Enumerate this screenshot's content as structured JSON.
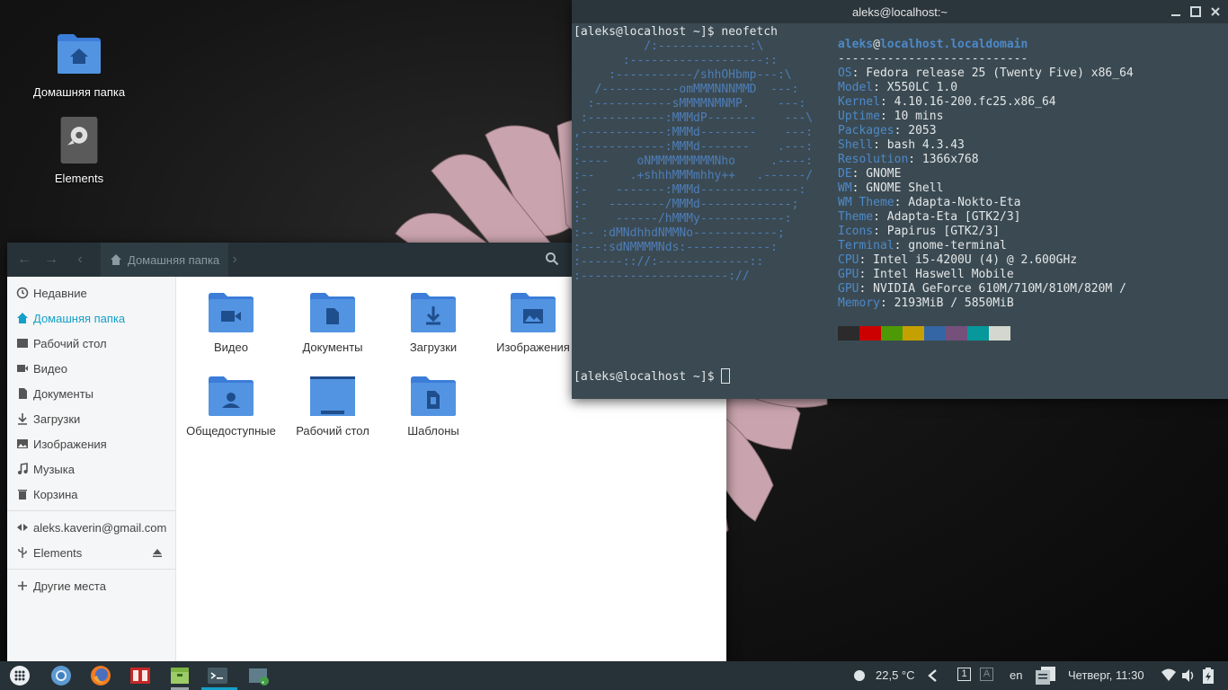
{
  "desktop": {
    "icons": [
      {
        "label": "Домашняя папка"
      },
      {
        "label": "Elements"
      }
    ]
  },
  "file_manager": {
    "breadcrumb": "Домашняя папка",
    "sidebar": [
      {
        "label": "Недавние"
      },
      {
        "label": "Домашняя папка"
      },
      {
        "label": "Рабочий стол"
      },
      {
        "label": "Видео"
      },
      {
        "label": "Документы"
      },
      {
        "label": "Загрузки"
      },
      {
        "label": "Изображения"
      },
      {
        "label": "Музыка"
      },
      {
        "label": "Корзина"
      },
      {
        "label": "aleks.kaverin@gmail.com"
      },
      {
        "label": "Elements"
      },
      {
        "label": "Другие места"
      }
    ],
    "folders": [
      {
        "label": "Видео"
      },
      {
        "label": "Документы"
      },
      {
        "label": "Загрузки"
      },
      {
        "label": "Изображения"
      },
      {
        "label": "Общедоступные"
      },
      {
        "label": "Рабочий стол"
      },
      {
        "label": "Шаблоны"
      }
    ]
  },
  "terminal": {
    "title": "aleks@localhost:~",
    "prompt": "[aleks@localhost ~]$ ",
    "command": "neofetch",
    "user": "aleks",
    "at": "@",
    "host": "localhost.localdomain",
    "separator": "---------------------------",
    "info": [
      {
        "key": "OS",
        "value": "Fedora release 25 (Twenty Five) x86_64"
      },
      {
        "key": "Model",
        "value": "X550LC 1.0"
      },
      {
        "key": "Kernel",
        "value": "4.10.16-200.fc25.x86_64"
      },
      {
        "key": "Uptime",
        "value": "10 mins"
      },
      {
        "key": "Packages",
        "value": "2053"
      },
      {
        "key": "Shell",
        "value": "bash 4.3.43"
      },
      {
        "key": "Resolution",
        "value": "1366x768"
      },
      {
        "key": "DE",
        "value": "GNOME"
      },
      {
        "key": "WM",
        "value": "GNOME Shell"
      },
      {
        "key": "WM Theme",
        "value": "Adapta-Nokto-Eta"
      },
      {
        "key": "Theme",
        "value": "Adapta-Eta [GTK2/3]"
      },
      {
        "key": "Icons",
        "value": "Papirus [GTK2/3]"
      },
      {
        "key": "Terminal",
        "value": "gnome-terminal"
      },
      {
        "key": "CPU",
        "value": "Intel i5-4200U (4) @ 2.600GHz"
      },
      {
        "key": "GPU",
        "value": "Intel Haswell Mobile"
      },
      {
        "key": "GPU",
        "value": "NVIDIA GeForce 610M/710M/810M/820M /"
      },
      {
        "key": "Memory",
        "value": "2193MiB / 5850MiB"
      }
    ],
    "palette": [
      "#2b2b2b",
      "#cc0000",
      "#4e9a06",
      "#c4a000",
      "#3465a4",
      "#75507b",
      "#06989a",
      "#d3d7cf"
    ],
    "logo": [
      "          /:-------------:\\",
      "       :-------------------::",
      "     :-----------/shhOHbmp---:\\",
      "   /-----------omMMMNNNMMD  ---:",
      "  :-----------sMMMMNMNMP.    ---:",
      " :-----------:MMMdP-------    ---\\",
      ",------------:MMMd--------    ---:",
      ":------------:MMMd-------    .---:",
      ":----    oNMMMMMMMMMNho     .----:",
      ":--     .+shhhMMMmhhy++   .------/",
      ":-    -------:MMMd--------------:",
      ":-   --------/MMMd-------------;",
      ":-    ------/hMMMy------------:",
      ":-- :dMNdhhdNMMNo------------;",
      ":---:sdNMMMMNds:------------:",
      ":------:://:-------------::",
      ":---------------------://"
    ]
  },
  "taskbar": {
    "temperature": "22,5 °C",
    "workspace": "1",
    "workspace2": "A",
    "lang": "en",
    "clock": "Четверг, 11:30"
  }
}
